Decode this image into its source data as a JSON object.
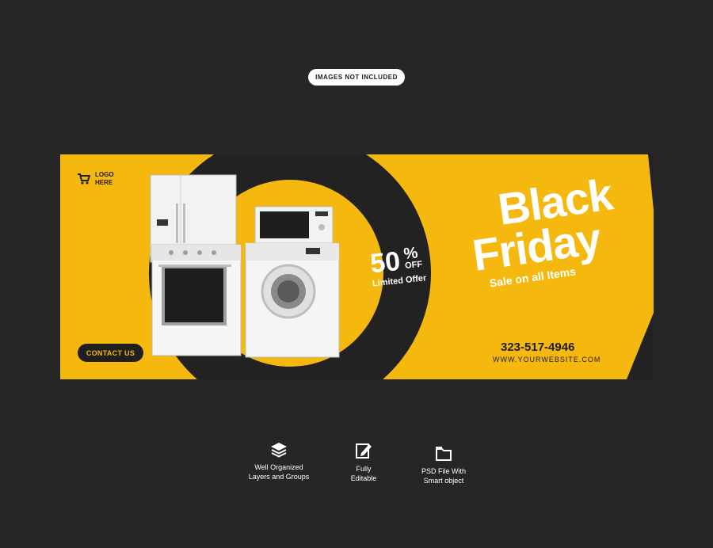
{
  "badge": "IMAGES NOT INCLUDED",
  "banner": {
    "logo": {
      "line1": "LOGO",
      "line2": "HERE",
      "icon": "shopping-cart-icon"
    },
    "contact_button": "CONTACT US",
    "offer": {
      "percent": "50",
      "percent_sign": "%",
      "off": "OFF",
      "label": "Limited Offer"
    },
    "title_line1": "Black",
    "title_line2": "Friday",
    "subtitle": "Sale on all Items",
    "phone": "323-517-4946",
    "website": "WWW.YOURWEBSITE.COM",
    "colors": {
      "accent": "#f4b80f",
      "dark": "#1f1f1f"
    }
  },
  "features": [
    {
      "icon": "layers-icon",
      "line1": "Well Organized",
      "line2": "Layers and Groups"
    },
    {
      "icon": "edit-icon",
      "line1": "Fully",
      "line2": "Editable"
    },
    {
      "icon": "folder-icon",
      "line1": "PSD File With",
      "line2": "Smart object"
    }
  ]
}
